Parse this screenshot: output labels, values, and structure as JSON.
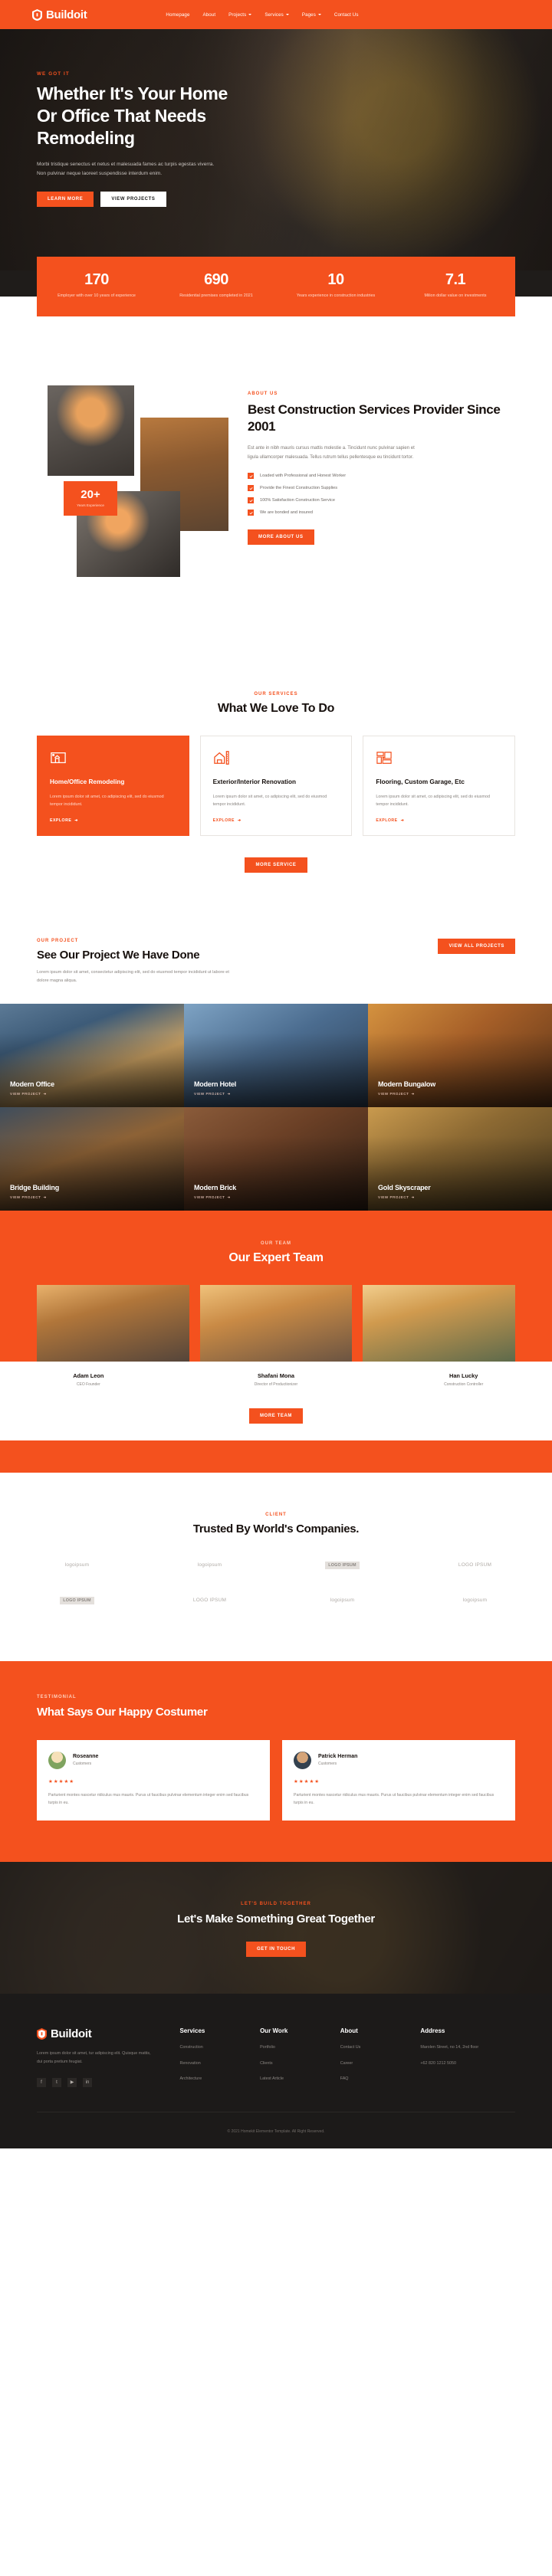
{
  "brand": {
    "name": "Buildoit"
  },
  "nav": {
    "items": [
      {
        "label": "Homepage",
        "dropdown": false
      },
      {
        "label": "About",
        "dropdown": false
      },
      {
        "label": "Projects",
        "dropdown": true
      },
      {
        "label": "Services",
        "dropdown": true
      },
      {
        "label": "Pages",
        "dropdown": true
      },
      {
        "label": "Contact Us",
        "dropdown": false
      }
    ]
  },
  "hero": {
    "eyebrow": "WE GOT IT",
    "title": "Whether It's Your Home Or Office That Needs Remodeling",
    "paragraph": "Morbi tristique senectus et netus et malesuada fames ac turpis egestas viverra. Non pulvinar neque laoreet suspendisse interdum enim.",
    "primary_button": "LEARN MORE",
    "secondary_button": "VIEW PROJECTS"
  },
  "stats": [
    {
      "value": "170",
      "label": "Employer with over 10 years of experience"
    },
    {
      "value": "690",
      "label": "Residential premises completed in 2021"
    },
    {
      "value": "10",
      "label": "Years experience in construction industries"
    },
    {
      "value": "7.1",
      "label": "Milion dollar value on investments"
    }
  ],
  "about": {
    "eyebrow": "ABOUT US",
    "title": "Best Construction Services Provider Since 2001",
    "paragraph": "Est ante in nibh mauris cursus mattis molestie a. Tincidunt nunc pulvinar sapien et ligula ullamcorper malesuada. Tellus rutrum tellus pellentesque eu tincidunt tortor.",
    "badge_number": "20+",
    "badge_text": "Years Experience",
    "checks": [
      "Loaded with Professional and Honest Worker",
      "Provide the Finest Construction Supplies",
      "100% Satisfaction Construction Service",
      "We are bonded and insured"
    ],
    "button": "MORE ABOUT US"
  },
  "services": {
    "eyebrow": "OUR SERVICES",
    "title": "What We Love To Do",
    "more_button": "MORE SERVICE",
    "explore_label": "EXPLORE",
    "cards": [
      {
        "icon": "blueprint-icon",
        "title": "Home/Office Remodeling",
        "text": "Lorem ipsum dolor sit amet, co adipiscing elit, sed do eiusmod tempor incididunt."
      },
      {
        "icon": "house-ruler-icon",
        "title": "Exterior/Interior Renovation",
        "text": "Lorem ipsum dolor sit amet, co adipiscing elit, sed do eiusmod tempor incididunt."
      },
      {
        "icon": "flooring-icon",
        "title": "Flooring, Custom Garage, Etc",
        "text": "Lorem ipsum dolor sit amet, co adipiscing elit, sed do eiusmod tempor incididunt."
      }
    ]
  },
  "projects": {
    "eyebrow": "OUR PROJECT",
    "title": "See Our Project We Have Done",
    "paragraph": "Lorem ipsum dolor sit amet, consectetur adipiscing elit, sed do eiusmod tempor incididunt ut labore et dolore magna aliqua.",
    "view_all_button": "VIEW ALL PROJECTS",
    "view_label": "VIEW PROJECT",
    "items": [
      {
        "name": "Modern Office"
      },
      {
        "name": "Modern Hotel"
      },
      {
        "name": "Modern Bungalow"
      },
      {
        "name": "Bridge Building"
      },
      {
        "name": "Modern Brick"
      },
      {
        "name": "Gold Skyscraper"
      }
    ]
  },
  "team": {
    "eyebrow": "OUR TEAM",
    "title": "Our Expert Team",
    "button": "MORE TEAM",
    "members": [
      {
        "name": "Adam Leon",
        "role": "CEO Founder"
      },
      {
        "name": "Shafani Mona",
        "role": "Director of Productionizer"
      },
      {
        "name": "Han Lucky",
        "role": "Construction Controller"
      }
    ]
  },
  "clients": {
    "eyebrow": "CLIENT",
    "title": "Trusted By World's Companies.",
    "logos_row1": [
      {
        "text": "logoipsum",
        "boxed": false
      },
      {
        "text": "logoipsum",
        "boxed": false
      },
      {
        "text": "LOGO IPSUM",
        "boxed": true
      },
      {
        "text": "LOGO IPSUM",
        "boxed": false
      }
    ],
    "logos_row2": [
      {
        "text": "LOGO IPSUM",
        "boxed": true
      },
      {
        "text": "LOGO IPSUM",
        "boxed": false
      },
      {
        "text": "logoipsum",
        "boxed": false
      },
      {
        "text": "logoipsum",
        "boxed": false
      }
    ]
  },
  "testimonial": {
    "eyebrow": "TESTIMONIAL",
    "title": "What Says Our Happy Costumer",
    "cards": [
      {
        "name": "Roseanne",
        "role": "Customers",
        "stars": "★★★★★",
        "text": "Parturient montes nascetur ridiculus mus mauris. Purus ut faucibus pulvinar elementum integer enim sed faucibus turpis in eu."
      },
      {
        "name": "Patrick Herman",
        "role": "Customers",
        "stars": "★★★★★",
        "text": "Parturient montes nascetur ridiculus mus mauris. Purus ut faucibus pulvinar elementum integer enim sed faucibus turpis in eu."
      }
    ]
  },
  "cta": {
    "eyebrow": "LET'S BUILD TOGETHER",
    "title": "Let's Make Something Great Together",
    "button": "GET IN TOUCH"
  },
  "footer": {
    "description": "Lorem ipsum dolor sit amet, tur adipiscing elit. Quisque mattis, dui porta pretium feugiat.",
    "socials": [
      "facebook-icon",
      "twitter-icon",
      "youtube-icon",
      "linkedin-icon"
    ],
    "columns": [
      {
        "heading": "Services",
        "links": [
          "Construction",
          "Renovation",
          "Architecture"
        ]
      },
      {
        "heading": "Our Work",
        "links": [
          "Portfolio",
          "Clients",
          "Latest Article"
        ]
      },
      {
        "heading": "About",
        "links": [
          "Contact Us",
          "Career",
          "FAQ"
        ]
      }
    ],
    "address": {
      "heading": "Address",
      "lines": [
        "Marolen Street, no 14, 2nd floor",
        "+62 820 1212 5050"
      ]
    },
    "copyright": "© 2021 Homekit Elementor Template. All Right Reserved."
  },
  "colors": {
    "accent": "#F4511E",
    "dark": "#1c1a19"
  }
}
